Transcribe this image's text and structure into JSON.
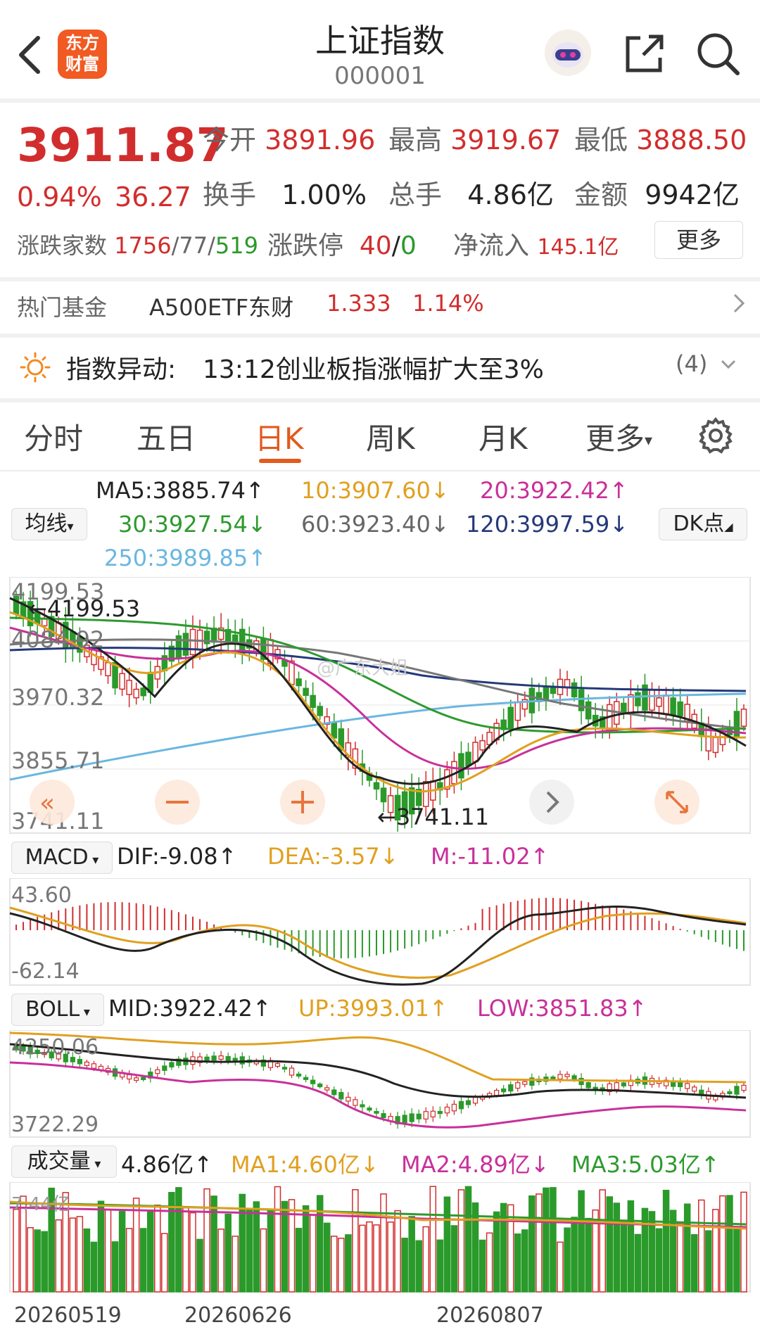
{
  "header": {
    "title": "上证指数",
    "code": "000001",
    "logo_line1": "东方",
    "logo_line2": "财富"
  },
  "quote": {
    "price": "3911.87",
    "change_pct": "0.94%",
    "change": "36.27",
    "open_label": "今开",
    "open": "3891.96",
    "high_label": "最高",
    "high": "3919.67",
    "low_label": "最低",
    "low": "3888.50",
    "turnover_label": "换手",
    "turnover": "1.00%",
    "volume_label": "总手",
    "volume": "4.86亿",
    "amount_label": "金额",
    "amount": "9942亿",
    "breadth_label": "涨跌家数",
    "breadth_up": "1756",
    "breadth_flat": "77",
    "breadth_down": "519",
    "limit_label": "涨跌停",
    "limit_up": "40",
    "limit_down": "0",
    "inflow_label": "净流入",
    "inflow": "145.1亿",
    "more_label": "更多"
  },
  "fund_row": {
    "label": "热门基金",
    "name": "A500ETF东财",
    "price": "1.333",
    "pct": "1.14%"
  },
  "alert_row": {
    "label": "指数异动:",
    "text": "13:12创业板指涨幅扩大至3%",
    "count": "(4)"
  },
  "tabs": [
    {
      "label": "分时"
    },
    {
      "label": "五日"
    },
    {
      "label": "日K"
    },
    {
      "label": "周K"
    },
    {
      "label": "月K"
    },
    {
      "label": "更多"
    }
  ],
  "ma_legend": {
    "selector": "均线",
    "dk": "DK点",
    "ma5": "MA5:3885.74↑",
    "ma10": "10:3907.60↓",
    "ma20": "20:3922.42↑",
    "ma30": "30:3927.54↓",
    "ma60": "60:3923.40↓",
    "ma120": "120:3997.59↓",
    "ma250": "250:3989.85↑"
  },
  "colors": {
    "up": "#d22d2d",
    "down": "#2a9a2a",
    "accent": "#e25a1c",
    "ma5": "#222222",
    "ma10": "#e0a020",
    "ma20": "#c8309a",
    "ma30": "#2e9a2e",
    "ma60": "#777777",
    "ma120": "#24397a",
    "ma250": "#6ab7e0"
  },
  "watermark": "@广东大姐",
  "chart_data": [
    {
      "type": "candlestick",
      "title": "",
      "y_ticks": [
        "4199.53",
        "4084.92",
        "3970.32",
        "3855.71",
        "3741.11"
      ],
      "ylim": [
        3741.11,
        4199.53
      ],
      "high_marker": "←4199.53",
      "low_marker": "←3741.11",
      "x_ticks": [
        "20260519",
        "20260626",
        "20260807"
      ],
      "series": [
        {
          "name": "MA5",
          "value": "3885.74",
          "color": "#222222"
        },
        {
          "name": "10",
          "value": "3907.60",
          "color": "#e0a020"
        },
        {
          "name": "20",
          "value": "3922.42",
          "color": "#c8309a"
        },
        {
          "name": "30",
          "value": "3927.54",
          "color": "#2e9a2e"
        },
        {
          "name": "60",
          "value": "3923.40",
          "color": "#777777"
        },
        {
          "name": "120",
          "value": "3997.59",
          "color": "#24397a"
        },
        {
          "name": "250",
          "value": "3989.85",
          "color": "#6ab7e0"
        }
      ]
    },
    {
      "type": "macd",
      "selector": "MACD",
      "dif": "DIF:-9.08↑",
      "dea": "DEA:-3.57↓",
      "m": "M:-11.02↑",
      "y_ticks": [
        "43.60",
        "-62.14"
      ],
      "ylim": [
        -62.14,
        43.6
      ]
    },
    {
      "type": "boll",
      "selector": "BOLL",
      "mid": "MID:3922.42↑",
      "up": "UP:3993.01↑",
      "low": "LOW:3851.83↑",
      "y_ticks": [
        "4250.06",
        "3722.29"
      ],
      "ylim": [
        3722.29,
        4250.06
      ]
    },
    {
      "type": "bar",
      "selector": "成交量",
      "vol": "4.86亿↑",
      "ma1": "MA1:4.60亿↓",
      "ma2": "MA2:4.89亿↓",
      "ma3": "MA3:5.03亿↑",
      "y_ticks": [
        "7.44亿"
      ]
    }
  ]
}
